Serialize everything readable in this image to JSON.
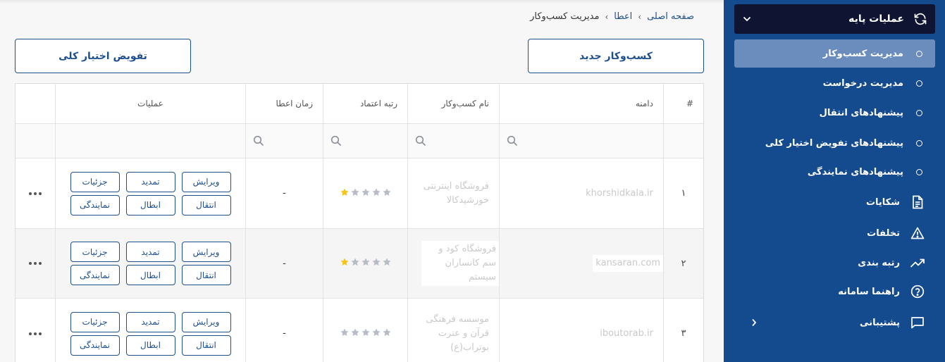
{
  "breadcrumb": {
    "home": "صفحه اصلی",
    "grant": "اعطا",
    "current": "مدیریت کسب‌وکار"
  },
  "buttons": {
    "new_business": "کسب‌وکار جدید",
    "full_delegation": "تفویض اختیار کلی"
  },
  "table": {
    "headers": {
      "num": "#",
      "domain": "دامنه",
      "business_name": "نام کسب‌وکار",
      "trust_rank": "رتبه اعتماد",
      "grant_time": "زمان اعطا",
      "operations": "عملیات"
    },
    "action_labels": {
      "edit": "ویرایش",
      "extend": "تمدید",
      "details": "جزئیات",
      "transfer": "انتقال",
      "revoke": "ابطال",
      "representation": "نمایندگی"
    },
    "rows": [
      {
        "num": "۱",
        "domain": "khorshidkala.ir",
        "business_name": "فروشگاه اینترنتی خورشیدکالا",
        "stars_filled": 1,
        "grant_time": "-"
      },
      {
        "num": "۲",
        "domain": "kansaran.com",
        "business_name": "فروشگاه کود و سم کانساران سیستم",
        "stars_filled": 1,
        "grant_time": "-"
      },
      {
        "num": "۳",
        "domain": "iboutorab.ir",
        "business_name": "موسسه فرهنگی قرآن و عترت بوتراب(ع)",
        "stars_filled": 0,
        "grant_time": "-"
      }
    ]
  },
  "sidebar": {
    "section_title": "عملیات پایه",
    "sub_items": [
      "مدیریت کسب‌وکار",
      "مدیریت درخواست",
      "پیشنهادهای انتقال",
      "پیشنهادهای تفویض اختیار کلی",
      "پیشنهادهای نمایندگی"
    ],
    "items": [
      {
        "label": "شکایات",
        "icon": "document-icon"
      },
      {
        "label": "تخلفات",
        "icon": "warning-icon"
      },
      {
        "label": "رتبه بندی",
        "icon": "trending-up-icon"
      },
      {
        "label": "راهنما سامانه",
        "icon": "help-circle-icon"
      },
      {
        "label": "پشتیبانی",
        "icon": "chat-icon"
      }
    ]
  },
  "colors": {
    "sidebar_bg": "#144a8e",
    "sidebar_top": "#0e1431",
    "active_item": "#6a8dbd",
    "accent": "#1d4f8f",
    "star_filled": "#f5c518",
    "star_empty": "#b8bcc6"
  }
}
